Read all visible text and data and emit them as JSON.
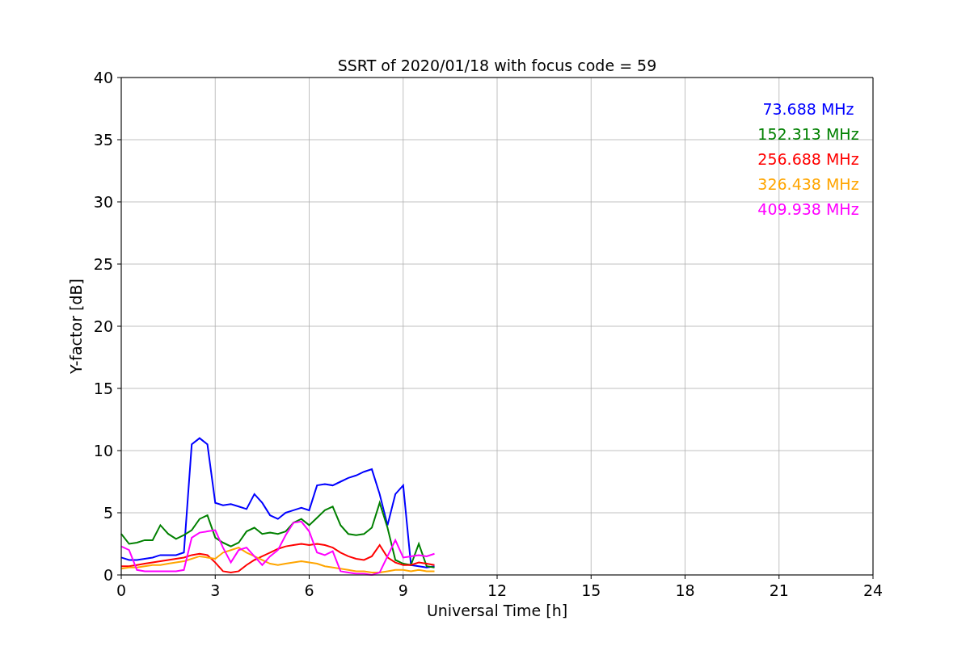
{
  "chart_data": {
    "type": "line",
    "title": "SSRT of 2020/01/18 with focus code = 59",
    "xlabel": "Universal Time [h]",
    "ylabel": "Y-factor [dB]",
    "x": [
      0,
      0.25,
      0.5,
      0.75,
      1,
      1.25,
      1.5,
      1.75,
      2,
      2.25,
      2.5,
      2.75,
      3,
      3.25,
      3.5,
      3.75,
      4,
      4.25,
      4.5,
      4.75,
      5,
      5.25,
      5.5,
      5.75,
      6,
      6.25,
      6.5,
      6.75,
      7,
      7.25,
      7.5,
      7.75,
      8,
      8.25,
      8.5,
      8.75,
      9,
      9.25,
      9.5,
      9.75,
      10
    ],
    "series": [
      {
        "name": "73.688 MHz",
        "color": "#0000ff",
        "values": [
          1.4,
          1.2,
          1.2,
          1.3,
          1.4,
          1.6,
          1.6,
          1.6,
          1.8,
          10.5,
          11,
          10.5,
          5.8,
          5.6,
          5.7,
          5.5,
          5.3,
          6.5,
          5.8,
          4.8,
          4.5,
          5.0,
          5.2,
          5.4,
          5.2,
          7.2,
          7.3,
          7.2,
          7.5,
          7.8,
          8.0,
          8.3,
          8.5,
          6.5,
          4.0,
          6.5,
          7.2,
          0.8,
          0.7,
          0.6,
          0.7
        ]
      },
      {
        "name": "152.313 MHz",
        "color": "#008000",
        "values": [
          3.3,
          2.5,
          2.6,
          2.8,
          2.8,
          4.0,
          3.3,
          2.9,
          3.2,
          3.6,
          4.5,
          4.8,
          3.0,
          2.6,
          2.3,
          2.6,
          3.5,
          3.8,
          3.3,
          3.4,
          3.3,
          3.5,
          4.2,
          4.5,
          4.0,
          4.6,
          5.2,
          5.5,
          4.0,
          3.3,
          3.2,
          3.3,
          3.8,
          5.8,
          3.8,
          1.2,
          0.9,
          0.8,
          2.5,
          0.7,
          0.6
        ]
      },
      {
        "name": "256.688 MHz",
        "color": "#ff0000",
        "values": [
          0.7,
          0.7,
          0.8,
          0.9,
          1.0,
          1.1,
          1.2,
          1.3,
          1.4,
          1.6,
          1.7,
          1.6,
          1.0,
          0.3,
          0.2,
          0.3,
          0.8,
          1.2,
          1.5,
          1.8,
          2.1,
          2.3,
          2.4,
          2.5,
          2.4,
          2.5,
          2.4,
          2.2,
          1.8,
          1.5,
          1.3,
          1.2,
          1.5,
          2.4,
          1.4,
          1.0,
          0.8,
          0.8,
          1.0,
          0.9,
          0.8
        ]
      },
      {
        "name": "326.438 MHz",
        "color": "#ffa500",
        "values": [
          0.5,
          0.6,
          0.6,
          0.7,
          0.8,
          0.8,
          0.9,
          1.0,
          1.1,
          1.3,
          1.5,
          1.4,
          1.3,
          1.8,
          2.0,
          2.2,
          1.8,
          1.5,
          1.2,
          0.9,
          0.8,
          0.9,
          1.0,
          1.1,
          1.0,
          0.9,
          0.7,
          0.6,
          0.5,
          0.4,
          0.3,
          0.3,
          0.2,
          0.2,
          0.3,
          0.4,
          0.4,
          0.3,
          0.4,
          0.3,
          0.3
        ]
      },
      {
        "name": "409.938 MHz",
        "color": "#ff00ff",
        "values": [
          2.3,
          2.0,
          0.4,
          0.3,
          0.3,
          0.3,
          0.3,
          0.3,
          0.4,
          3.0,
          3.4,
          3.5,
          3.6,
          2.2,
          1.0,
          2.0,
          2.2,
          1.5,
          0.8,
          1.5,
          2.0,
          3.2,
          4.2,
          4.3,
          3.5,
          1.8,
          1.6,
          1.9,
          0.3,
          0.2,
          0.1,
          0.1,
          0.0,
          0.2,
          1.5,
          2.8,
          1.4,
          1.5,
          1.6,
          1.5,
          1.7
        ]
      }
    ],
    "xlim": [
      0,
      24
    ],
    "ylim": [
      0,
      40
    ],
    "xticks": [
      0,
      3,
      6,
      9,
      12,
      15,
      18,
      21,
      24
    ],
    "yticks": [
      0,
      5,
      10,
      15,
      20,
      25,
      30,
      35,
      40
    ],
    "grid": true
  }
}
